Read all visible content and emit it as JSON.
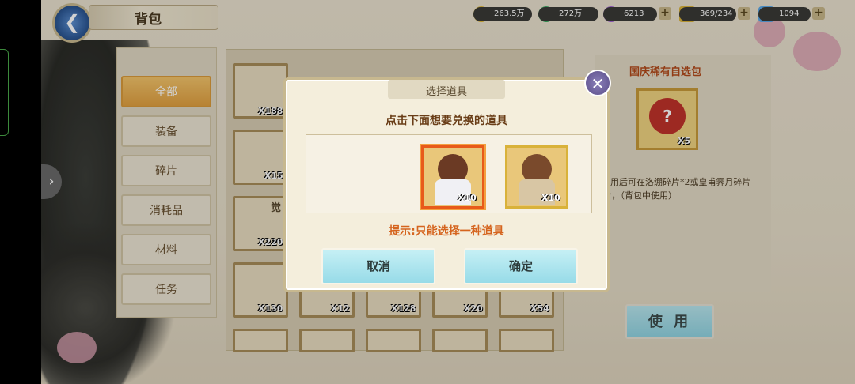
{
  "header": {
    "title": "背包"
  },
  "currencies": [
    {
      "name": "gold",
      "value": "263.5万",
      "color": "#e0b832"
    },
    {
      "name": "jade",
      "value": "272万",
      "color": "#3aa860"
    },
    {
      "name": "orb",
      "value": "6213",
      "color": "#a260d6"
    },
    {
      "name": "stamina",
      "value": "369/234",
      "color": "#d9b23a"
    },
    {
      "name": "diamond",
      "value": "1094",
      "color": "#5aa8e8"
    }
  ],
  "categories": [
    "全部",
    "装备",
    "碎片",
    "消耗品",
    "材料",
    "任务"
  ],
  "inventory": {
    "quantities": [
      "X188",
      "X15",
      "X220",
      "X130",
      "X12",
      "X128",
      "X20",
      "X54"
    ],
    "awaken_mark": "觉"
  },
  "detail": {
    "title": "国庆稀有自选包",
    "qty": "X5",
    "description": "使用后可在洛绷碎片*2或皇甫霁月碎片*2，（背包中使用）",
    "use_label": "使 用"
  },
  "modal": {
    "title": "选择道具",
    "prompt": "点击下面想要兑换的道具",
    "options": [
      {
        "qty": "X10",
        "selected": true
      },
      {
        "qty": "X10",
        "selected": false
      }
    ],
    "hint": "提示:只能选择一种道具",
    "cancel_label": "取消",
    "confirm_label": "确定"
  },
  "colors": {
    "accent": "#e0a040",
    "modal_button": "#97dbe8"
  }
}
